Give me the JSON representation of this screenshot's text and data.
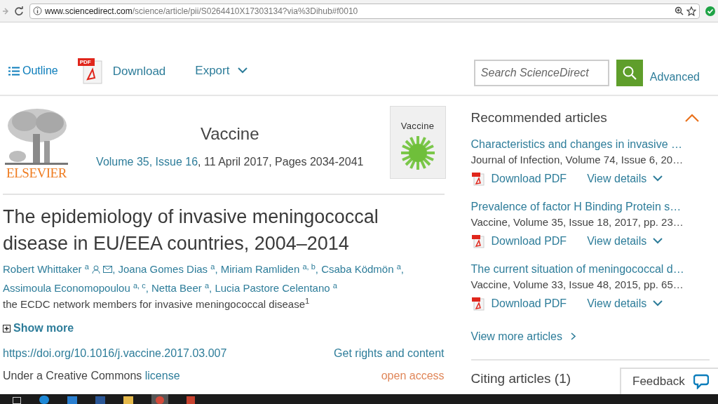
{
  "browser": {
    "url_host": "www.sciencedirect.com",
    "url_path": "/science/article/pii/S0264410X17303134?via%3Dihub#f0010"
  },
  "toolbar": {
    "outline": "Outline",
    "download": "Download",
    "pdf_badge": "PDF",
    "export": "Export",
    "search_placeholder": "Search ScienceDirect",
    "advanced": "Advanced"
  },
  "journal": {
    "publisher": "ELSEVIER",
    "name": "Vaccine",
    "volume_issue": "Volume 35, Issue 16",
    "details": ", 11 April 2017, Pages 2034-2041",
    "cover_title": "Vaccine"
  },
  "article": {
    "title": "The epidemiology of invasive meningococcal disease in EU/EEA countries, 2004–2014",
    "authors": [
      {
        "name": "Robert Whittaker",
        "marks": "a",
        "contact": true,
        "separator": ","
      },
      {
        "name": "Joana Gomes Dias",
        "marks": "a",
        "contact": false,
        "separator": ","
      },
      {
        "name": "Miriam Ramliden",
        "marks": "a, b",
        "contact": false,
        "separator": ","
      },
      {
        "name": "Csaba Ködmön",
        "marks": "a",
        "contact": false,
        "separator": ","
      },
      {
        "name": "Assimoula Economopoulou",
        "marks": "a, c",
        "contact": false,
        "separator": ","
      },
      {
        "name": "Netta Beer",
        "marks": "a",
        "contact": false,
        "separator": ","
      },
      {
        "name": "Lucia Pastore Celentano",
        "marks": "a",
        "contact": false
      }
    ],
    "group": "the ECDC network members for invasive meningococcal disease$^{1}$",
    "show_more": "Show more",
    "doi": "https://doi.org/10.1016/j.vaccine.2017.03.007",
    "rights": "Get rights and content",
    "license_text": "Under a Creative Commons",
    "license_link": "license",
    "access": "open access"
  },
  "recommended": {
    "heading": "Recommended articles",
    "expanded": true,
    "items": [
      {
        "title": "Characteristics and changes in invasive …",
        "source": "Journal of Infection, Volume 74, Issue 6, 20…",
        "download": "Download PDF",
        "details": "View details"
      },
      {
        "title": "Prevalence of factor H Binding Protein s…",
        "source": "Vaccine, Volume 35, Issue 18, 2017, pp. 23…",
        "download": "Download PDF",
        "details": "View details"
      },
      {
        "title": "The current situation of meningococcal d…",
        "source": "Vaccine, Volume 33, Issue 48, 2015, pp. 65…",
        "download": "Download PDF",
        "details": "View details"
      }
    ],
    "more": "View more articles"
  },
  "citing": {
    "heading": "Citing articles (1)"
  },
  "feedback": "Feedback"
}
